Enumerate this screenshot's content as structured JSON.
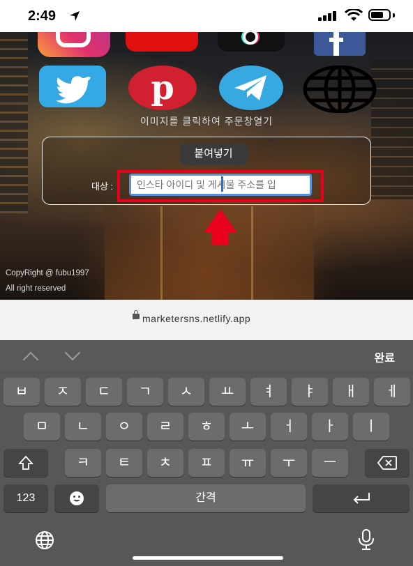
{
  "status_bar": {
    "time": "2:49"
  },
  "web": {
    "order_hint": "이미지를 클릭하여 주문창열기",
    "paste_button": "붙여넣기",
    "target_label": "대상 :",
    "target_input_placeholder": "인스타 아이디 및 게시물 주소를 입",
    "copyright": "CopyRight @ fubu1997",
    "rights": "All right reserved",
    "social_icons": [
      "instagram-icon",
      "youtube-icon",
      "tiktok-icon",
      "facebook-icon",
      "twitter-icon",
      "pinterest-icon",
      "telegram-icon",
      "globe-icon"
    ],
    "pinterest_letter": "p"
  },
  "url_bar": {
    "url": "marketersns.netlify.app"
  },
  "keyboard_toolbar": {
    "done": "완료"
  },
  "keyboard": {
    "row1": [
      "ㅂ",
      "ㅈ",
      "ㄷ",
      "ㄱ",
      "ㅅ",
      "ㅛ",
      "ㅕ",
      "ㅑ",
      "ㅐ",
      "ㅔ"
    ],
    "row2": [
      "ㅁ",
      "ㄴ",
      "ㅇ",
      "ㄹ",
      "ㅎ",
      "ㅗ",
      "ㅓ",
      "ㅏ",
      "ㅣ"
    ],
    "row3": [
      "ㅋ",
      "ㅌ",
      "ㅊ",
      "ㅍ",
      "ㅠ",
      "ㅜ",
      "ㅡ"
    ],
    "numbers_key": "123",
    "space_key": "간격"
  },
  "colors": {
    "highlight": "#e8001c",
    "keyboard_bg": "#575757",
    "key_bg": "#6c6c6c"
  }
}
